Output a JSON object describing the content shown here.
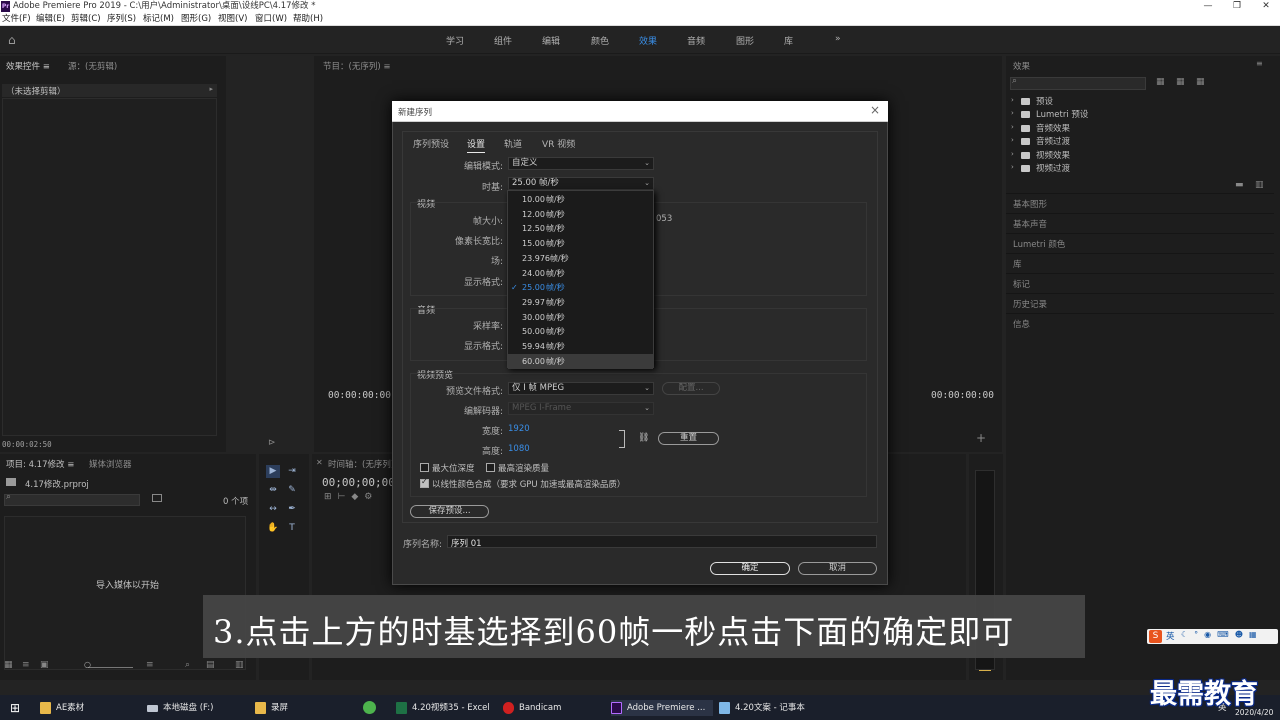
{
  "window": {
    "title": "Adobe Premiere Pro 2019 - C:\\用户\\Administrator\\桌面\\设线PC\\4.17修改 *",
    "logo_text": "Pr"
  },
  "menu": [
    "文件(F)",
    "编辑(E)",
    "剪辑(C)",
    "序列(S)",
    "标记(M)",
    "图形(G)",
    "视图(V)",
    "窗口(W)",
    "帮助(H)"
  ],
  "workspaces": {
    "items": [
      "学习",
      "组件",
      "编辑",
      "颜色",
      "效果",
      "音频",
      "图形",
      "库"
    ],
    "active": "效果",
    "more": "»"
  },
  "effect_controls": {
    "tab1": "效果控件 ≡",
    "tab2": "源：(无剪辑)",
    "no_clip": "（未选择剪辑）",
    "timecode": "00:00:02:50"
  },
  "program": {
    "tab": "节目：(无序列) ≡",
    "tc_left": "00:00:00:00",
    "tc_right": "00:00:00:00"
  },
  "project": {
    "tab1": "项目: 4.17修改 ≡",
    "tab2": "媒体浏览器",
    "file": "4.17修改.prproj",
    "count": "0 个项",
    "import_hint": "导入媒体以开始"
  },
  "timeline": {
    "tab": "时间轴：(无序列) ≡",
    "timecode": "00;00;00;00"
  },
  "effects_panel": {
    "title": "效果",
    "tree": [
      "预设",
      "Lumetri 预设",
      "音频效果",
      "音频过渡",
      "视频效果",
      "视频过渡"
    ],
    "sections": [
      "基本图形",
      "基本声音",
      "Lumetri 颜色",
      "库",
      "标记",
      "历史记录",
      "信息"
    ]
  },
  "dialog": {
    "title": "新建序列",
    "tabs": [
      "序列预设",
      "设置",
      "轨道",
      "VR 视频"
    ],
    "active_tab": "设置",
    "editing_mode_label": "编辑模式:",
    "editing_mode_value": "自定义",
    "timebase_label": "时基:",
    "timebase_value": "25.00  帧/秒",
    "video_section": "视频",
    "frame_size_label": "帧大小:",
    "frame_size_partial": "053",
    "pixel_aspect_label": "像素长宽比:",
    "fields_label": "场:",
    "display_format_label": "显示格式:",
    "audio_section": "音频",
    "sample_rate_label": "采样率:",
    "audio_display_label": "显示格式:",
    "preview_section": "视频预览",
    "preview_format_label": "预览文件格式:",
    "preview_format_value": "仅 I 帧 MPEG",
    "configure_button": "配置...",
    "codec_label": "编解码器:",
    "codec_value": "MPEG I-Frame",
    "width_label": "宽度:",
    "width_value": "1920",
    "height_label": "高度:",
    "height_value": "1080",
    "reset_button": "重置",
    "max_depth": "最大位深度",
    "max_quality": "最高渲染质量",
    "linear_color": "以线性颜色合成（要求 GPU 加速或最高渲染品质）",
    "save_preset": "保存预设...",
    "seq_name_label": "序列名称:",
    "seq_name_value": "序列 01",
    "ok": "确定",
    "cancel": "取消"
  },
  "timebase_dropdown": {
    "options": [
      {
        "num": "10.00",
        "unit": "帧/秒"
      },
      {
        "num": "12.00",
        "unit": "帧/秒"
      },
      {
        "num": "12.50",
        "unit": "帧/秒"
      },
      {
        "num": "15.00",
        "unit": "帧/秒"
      },
      {
        "num": "23.976",
        "unit": "帧/秒"
      },
      {
        "num": "24.00",
        "unit": "帧/秒"
      },
      {
        "num": "25.00",
        "unit": "帧/秒"
      },
      {
        "num": "29.97",
        "unit": "帧/秒"
      },
      {
        "num": "30.00",
        "unit": "帧/秒"
      },
      {
        "num": "50.00",
        "unit": "帧/秒"
      },
      {
        "num": "59.94",
        "unit": "帧/秒"
      },
      {
        "num": "60.00",
        "unit": "帧/秒"
      }
    ],
    "selected_index": 6,
    "hover_index": 11
  },
  "caption": "3.点击上方的时基选择到60帧一秒点击下面的确定即可",
  "taskbar": {
    "items": [
      "AE素材",
      "本地磁盘 (F:)",
      "录屏",
      "4.20视频35 - Excel",
      "Bandicam",
      "Adobe Premiere ...",
      "4.20文案 - 记事本"
    ],
    "ime": "英",
    "date": "2020/4/20"
  },
  "watermark": "最需教育"
}
